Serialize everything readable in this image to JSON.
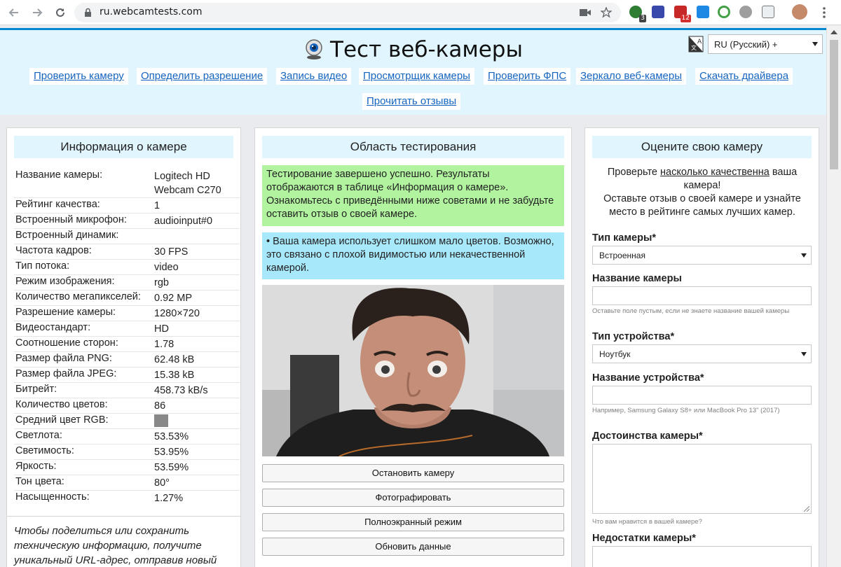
{
  "browser": {
    "url": "ru.webcamtests.com",
    "ext_badges": [
      "3",
      "12"
    ]
  },
  "header": {
    "title": "Тест веб-камеры",
    "lang_value": "RU (Русский) +",
    "nav": [
      "Проверить камеру",
      "Определить разрешение",
      "Запись видео",
      "Просмотрщик камеры",
      "Проверить ФПС",
      "Зеркало веб-камеры",
      "Скачать драйвера",
      "Прочитать отзывы"
    ]
  },
  "info": {
    "title": "Информация о камере",
    "rows": [
      {
        "label": "Название камеры:",
        "value": "Logitech HD Webcam C270"
      },
      {
        "label": "Рейтинг качества:",
        "value": "1"
      },
      {
        "label": "Встроенный микрофон:",
        "value": "audioinput#0"
      },
      {
        "label": "Встроенный динамик:",
        "value": ""
      },
      {
        "label": "Частота кадров:",
        "value": "30 FPS"
      },
      {
        "label": "Тип потока:",
        "value": "video"
      },
      {
        "label": "Режим изображения:",
        "value": "rgb"
      },
      {
        "label": "Количество мегапикселей:",
        "value": "0.92 MP"
      },
      {
        "label": "Разрешение камеры:",
        "value": "1280×720"
      },
      {
        "label": "Видеостандарт:",
        "value": "HD"
      },
      {
        "label": "Соотношение сторон:",
        "value": "1.78"
      },
      {
        "label": "Размер файла PNG:",
        "value": "62.48 kB"
      },
      {
        "label": "Размер файла JPEG:",
        "value": "15.38 kB"
      },
      {
        "label": "Битрейт:",
        "value": "458.73 kB/s"
      },
      {
        "label": "Количество цветов:",
        "value": "86"
      },
      {
        "label": "Средний цвет RGB:",
        "value": ""
      },
      {
        "label": "Светлота:",
        "value": "53.53%"
      },
      {
        "label": "Светимость:",
        "value": "53.95%"
      },
      {
        "label": "Яркость:",
        "value": "53.59%"
      },
      {
        "label": "Тон цвета:",
        "value": "80°"
      },
      {
        "label": "Насыщенность:",
        "value": "1.27%"
      }
    ],
    "avg_color": "#888888",
    "share_note": "Чтобы поделиться или сохранить техническую информацию, получите уникальный URL-адрес, отправив новый"
  },
  "test": {
    "title": "Область тестирования",
    "success_msg": "Тестирование завершено успешно. Результаты отображаются в таблице «Информация о камере». Ознакомьтесь с приведёнными ниже советами и не забудьте оставить отзыв о своей камере.",
    "tip_msg": "• Ваша камера использует слишком мало цветов. Возможно, это связано с плохой видимостью или некачественной камерой.",
    "buttons": [
      "Остановить камеру",
      "Фотографировать",
      "Полноэкранный режим",
      "Обновить данные"
    ]
  },
  "rate": {
    "title": "Оцените свою камеру",
    "intro_pre": "Проверьте ",
    "intro_link": "насколько качественна",
    "intro_post": " ваша камера!",
    "intro_line2": "Оставьте отзыв о своей камере и узнайте место в рейтинге самых лучших камер.",
    "camera_type_label": "Тип камеры*",
    "camera_type_value": "Встроенная",
    "camera_name_label": "Название камеры",
    "camera_name_hint": "Оставьте поле пустым, если не знаете название вашей камеры",
    "device_type_label": "Тип устройства*",
    "device_type_value": "Ноутбук",
    "device_name_label": "Название устройства*",
    "device_name_hint": "Например, Samsung Galaxy S8+ или MacBook Pro 13\" (2017)",
    "pros_label": "Достоинства камеры*",
    "pros_hint": "Что вам нравится в вашей камере?",
    "cons_label": "Недостатки камеры*"
  }
}
